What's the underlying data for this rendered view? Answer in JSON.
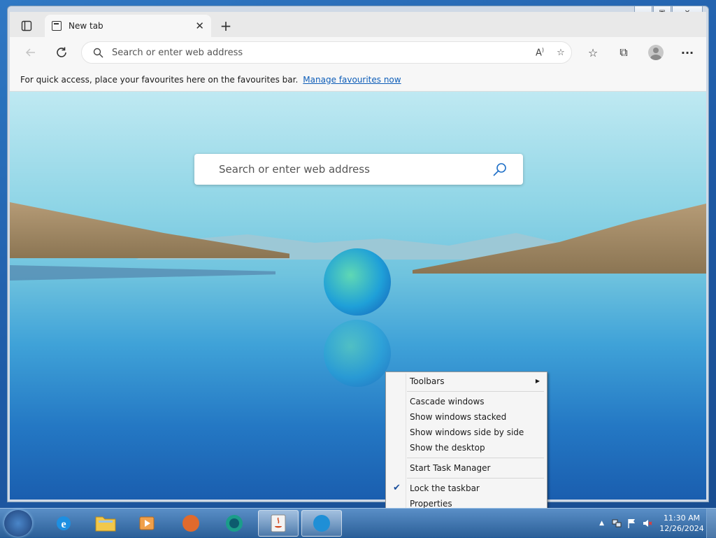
{
  "browser": {
    "tab_title": "New tab",
    "address_placeholder": "Search or enter web address",
    "favbar_text": "For quick access, place your favourites here on the favourites bar.",
    "favbar_link": "Manage favourites now",
    "page_search_placeholder": "Search or enter web address"
  },
  "context_menu": {
    "items": [
      {
        "label": "Toolbars"
      },
      {
        "label": "Cascade windows"
      },
      {
        "label": "Show windows stacked"
      },
      {
        "label": "Show windows side by side"
      },
      {
        "label": "Show the desktop"
      },
      {
        "label": "Start Task Manager"
      },
      {
        "label": "Lock the taskbar",
        "checked": true
      },
      {
        "label": "Properties"
      }
    ]
  },
  "taskbar": {
    "time": "11:30 AM",
    "date": "12/26/2024"
  }
}
